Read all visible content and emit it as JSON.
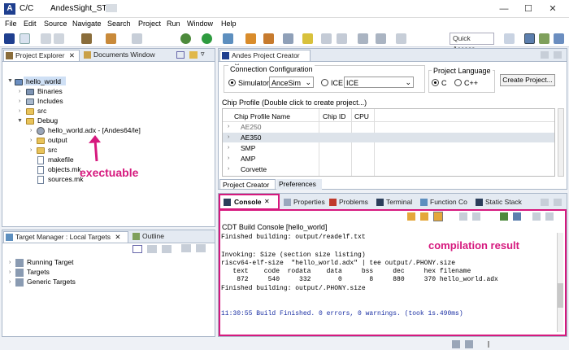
{
  "window": {
    "title_app": "C/C",
    "title_ws": "AndesSight_STD",
    "minimize": "—",
    "maximize": "☐",
    "close": "✕"
  },
  "menu": [
    "File",
    "Edit",
    "Source",
    "Navigate",
    "Search",
    "Project",
    "Run",
    "Window",
    "Help"
  ],
  "toolbar": {
    "quick_access": "Quick Access"
  },
  "project_explorer": {
    "tab_label": "Project Explorer",
    "tab2_label": "Documents Window",
    "items": [
      {
        "label": "hello_world",
        "depth": 0,
        "expanded": true,
        "icon": "project-icon",
        "selected": true
      },
      {
        "label": "Binaries",
        "depth": 1,
        "expanded": false,
        "icon": "binaries-icon"
      },
      {
        "label": "Includes",
        "depth": 1,
        "expanded": false,
        "icon": "includes-icon"
      },
      {
        "label": "src",
        "depth": 1,
        "expanded": false,
        "icon": "folder-icon"
      },
      {
        "label": "Debug",
        "depth": 1,
        "expanded": true,
        "icon": "folder-icon"
      },
      {
        "label": "hello_world.adx - [Andes64/le]",
        "depth": 2,
        "expanded": false,
        "icon": "executable-icon"
      },
      {
        "label": "output",
        "depth": 2,
        "expanded": false,
        "icon": "folder-icon"
      },
      {
        "label": "src",
        "depth": 2,
        "expanded": false,
        "icon": "folder-icon"
      },
      {
        "label": "makefile",
        "depth": 2,
        "icon": "file-icon"
      },
      {
        "label": "objects.mk",
        "depth": 2,
        "icon": "file-icon"
      },
      {
        "label": "sources.mk",
        "depth": 2,
        "icon": "file-icon"
      }
    ],
    "annotation": "exectuable"
  },
  "target_manager": {
    "tab_label": "Target Manager : Local Targets",
    "tab2_label": "Outline",
    "items": [
      "Running Target",
      "Targets",
      "Generic Targets"
    ]
  },
  "creator": {
    "tab_label": "Andes Project Creator",
    "conn_legend": "Connection Configuration",
    "simulator_label": "Simulator",
    "simulator_value": "AnceSim",
    "ice_label": "ICE",
    "ice_value": "ICE",
    "lang_legend": "Project Language",
    "lang_c": "C",
    "lang_cpp": "C++",
    "create_button": "Create Project...",
    "chip_legend": "Chip Profile (Double click to create project...)",
    "columns": [
      "Chip Profile Name",
      "Chip ID",
      "CPU"
    ],
    "rows": [
      "AE250",
      "AE350",
      "SMP",
      "AMP",
      "Corvette"
    ],
    "bottom_tabs": [
      "Project Creator",
      "Preferences"
    ]
  },
  "console": {
    "tabs": [
      "Console",
      "Properties",
      "Problems",
      "Terminal",
      "Function Co",
      "Static Stack"
    ],
    "title": "CDT Build Console [hello_world]",
    "annotation": "compilation result",
    "lines": [
      "Finished building: output/readelf.txt",
      "",
      "Invoking: Size (section size listing)",
      "riscv64-elf-size  \"hello_world.adx\" | tee output/.PHONY.size",
      "   text    code  rodata    data     bss     dec     hex filename",
      "    872     540     332       0       8     880     370 hello_world.adx",
      "Finished building: output/.PHONY.size",
      "",
      "",
      "11:30:55 Build Finished. 0 errors, 0 warnings. (took 1s.490ms)"
    ]
  },
  "colors": {
    "accent": "#d6197e",
    "final_line": "#1a2fa3"
  }
}
